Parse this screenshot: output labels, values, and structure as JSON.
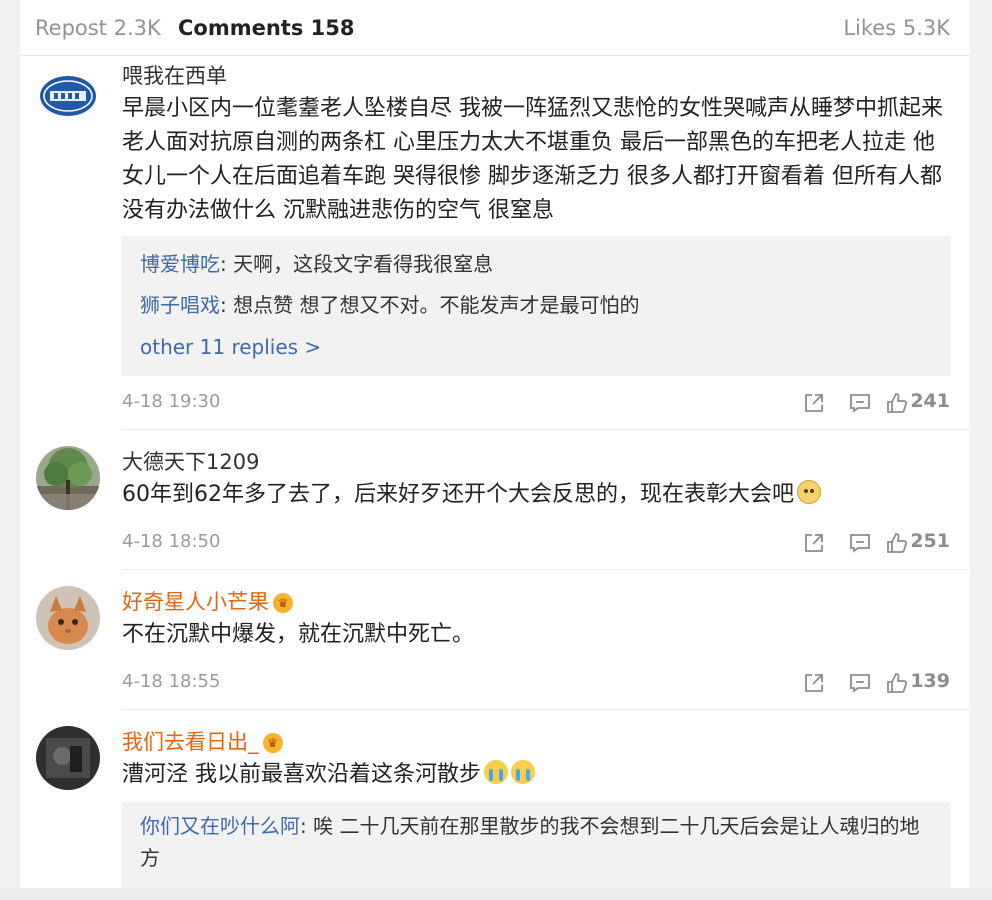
{
  "tabs": {
    "repost": "Repost 2.3K",
    "comments": "Comments 158",
    "likes": "Likes 5.3K"
  },
  "comments": [
    {
      "username": "喂我在西单",
      "avatar": "sebs-logo-avatar",
      "text": "早晨小区内一位耄耋老人坠楼自尽 我被一阵猛烈又悲怆的女性哭喊声从睡梦中抓起来 老人面对抗原自测的两条杠 心里压力太大不堪重负 最后一部黑色的车把老人拉走 他女儿一个人在后面追着车跑 哭得很惨 脚步逐渐乏力 很多人都打开窗看着 但所有人都没有办法做什么 沉默融进悲伤的空气 很窒息",
      "replies": [
        {
          "name": "博爱博吃",
          "text": ": 天啊，这段文字看得我很窒息"
        },
        {
          "name": "狮子唱戏",
          "text": ": 想点赞 想了想又不对。不能发声才是最可怕的"
        }
      ],
      "more_replies": "other 11 replies >",
      "time": "4-18 19:30",
      "likes": "241"
    },
    {
      "username": "大德天下1209",
      "avatar": "tree-photo-avatar",
      "text": "60年到62年多了去了，后来好歹还开个大会反思的，现在表彰大会吧",
      "emoji": "doge-emoji",
      "time": "4-18 18:50",
      "likes": "251"
    },
    {
      "username": "好奇星人小芒果",
      "avatar": "kitten-photo-avatar",
      "text": "不在沉默中爆发，就在沉默中死亡。",
      "time": "4-18 18:55",
      "likes": "139"
    },
    {
      "username": "我们去看日出_",
      "avatar": "dark-photo-avatar",
      "text": "漕河泾 我以前最喜欢沿着这条河散步",
      "emoji": "crying-emoji",
      "replies": [
        {
          "name": "你们又在吵什么阿",
          "text": ": 唉 二十几天前在那里散步的我不会想到二十几天后会是让人魂归的地方"
        }
      ],
      "time": "",
      "likes": ""
    }
  ],
  "colors": {
    "link": "#3f6aa8",
    "vip_name": "#e8650f",
    "meta_gray": "#9a9a9a",
    "reply_bg": "#f2f2f2"
  }
}
